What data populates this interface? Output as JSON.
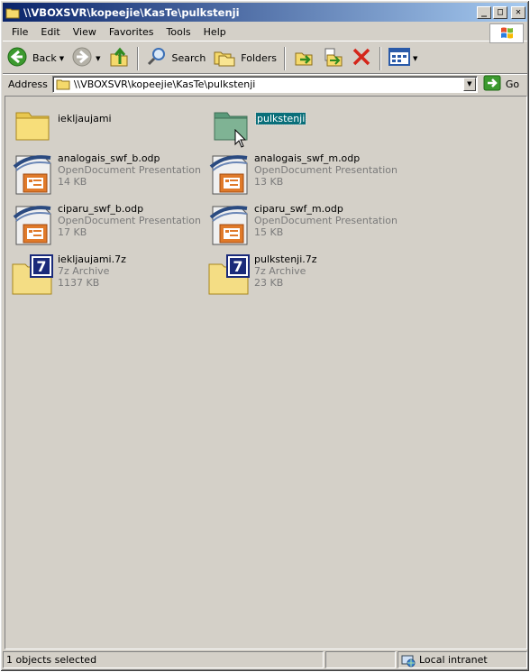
{
  "window": {
    "title": "\\\\VBOXSVR\\kopeejie\\KasTe\\pulkstenji"
  },
  "title_buttons": {
    "minimize": "_",
    "maximize": "□",
    "close": "✕"
  },
  "menu": [
    "File",
    "Edit",
    "View",
    "Favorites",
    "Tools",
    "Help"
  ],
  "toolbar": {
    "back": "Back",
    "search": "Search",
    "folders": "Folders"
  },
  "address": {
    "label": "Address",
    "value": "\\\\VBOXSVR\\kopeejie\\KasTe\\pulkstenji",
    "go": "Go"
  },
  "files": [
    {
      "name": "iekljaujami",
      "type": "",
      "size": "",
      "kind": "folder",
      "selected": false
    },
    {
      "name": "pulkstenji",
      "type": "",
      "size": "",
      "kind": "folder",
      "selected": true
    },
    {
      "name": "analogais_swf_b.odp",
      "type": "OpenDocument Presentation",
      "size": "14 KB",
      "kind": "odp"
    },
    {
      "name": "analogais_swf_m.odp",
      "type": "OpenDocument Presentation",
      "size": "13 KB",
      "kind": "odp"
    },
    {
      "name": "ciparu_swf_b.odp",
      "type": "OpenDocument Presentation",
      "size": "17 KB",
      "kind": "odp"
    },
    {
      "name": "ciparu_swf_m.odp",
      "type": "OpenDocument Presentation",
      "size": "15 KB",
      "kind": "odp"
    },
    {
      "name": "iekljaujami.7z",
      "type": "7z Archive",
      "size": "1137 KB",
      "kind": "7z"
    },
    {
      "name": "pulkstenji.7z",
      "type": "7z Archive",
      "size": "23 KB",
      "kind": "7z"
    }
  ],
  "status": {
    "selection": "1 objects selected",
    "zone": "Local intranet"
  },
  "colors": {
    "titlebar_start": "#0a246a",
    "titlebar_end": "#a6caf0",
    "selection": "#0a6f7a",
    "window_bg": "#d4d0c8"
  }
}
